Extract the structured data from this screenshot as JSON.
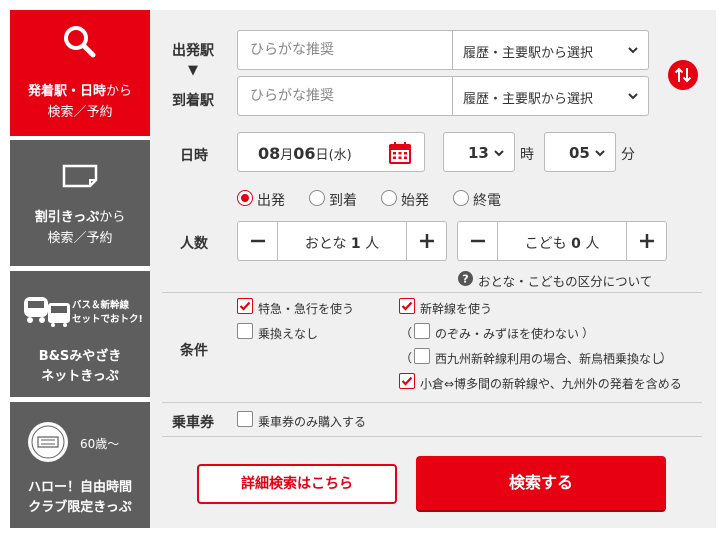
{
  "sidebar": {
    "tab1": {
      "line1_bold": "発着駅・日時",
      "line1_light": "から",
      "line2": "検索／予約"
    },
    "tab2": {
      "line1_bold": "割引きっぷ",
      "line1_light": "から",
      "line2": "検索／予約"
    },
    "tab3": {
      "badge1": "バス＆新幹線",
      "badge2": "セットでおトク!",
      "line1": "B&Sみやざき",
      "line2": "ネットきっぷ"
    },
    "tab4": {
      "age": "60歳〜",
      "line1": "ハロー！自由時間",
      "line2": "クラブ限定きっぷ"
    }
  },
  "station": {
    "departure_label": "出発駅",
    "arrow": "▼",
    "arrival_label": "到着駅",
    "departure_placeholder": "ひらがな推奨",
    "arrival_placeholder": "ひらがな推奨",
    "history_select": "履歴・主要駅から選択"
  },
  "datetime": {
    "label": "日時",
    "month": "08",
    "month_unit": "月",
    "day": "06",
    "day_unit": "日",
    "weekday": "(水)",
    "hour": "13",
    "hour_unit": "時",
    "minute": "05",
    "minute_unit": "分"
  },
  "time_mode": {
    "options": [
      "出発",
      "到着",
      "始発",
      "終電"
    ],
    "selected": "出発"
  },
  "passengers": {
    "label": "人数",
    "adult_label": "おとな",
    "adult_count": "1",
    "adult_unit": "人",
    "child_label": "こども",
    "child_count": "0",
    "child_unit": "人",
    "help_text": "おとな・こどもの区分について"
  },
  "conditions": {
    "label": "条件",
    "express": {
      "label": "特急・急行を使う",
      "checked": true
    },
    "no_transfer": {
      "label": "乗換えなし",
      "checked": false
    },
    "shinkansen": {
      "label": "新幹線を使う",
      "checked": true
    },
    "no_nozomi": {
      "label": "のぞみ・みずほを使わない",
      "checked": false
    },
    "nishi_kyushu": {
      "label": "西九州新幹線利用の場合、新鳥栖乗換なし",
      "checked": false
    },
    "kokura": {
      "label": "小倉⇔博多間の新幹線や、九州外の発着を含める",
      "checked": true
    },
    "paren_open": "（",
    "paren_close": "）"
  },
  "ticket": {
    "label": "乗車券",
    "only_ticket": {
      "label": "乗車券のみ購入する",
      "checked": false
    }
  },
  "buttons": {
    "detail": "詳細検索はこちら",
    "search": "検索する"
  },
  "colors": {
    "accent": "#e60012",
    "panel": "#f0f0f0",
    "sidebar_gray": "#5e5e5e"
  }
}
